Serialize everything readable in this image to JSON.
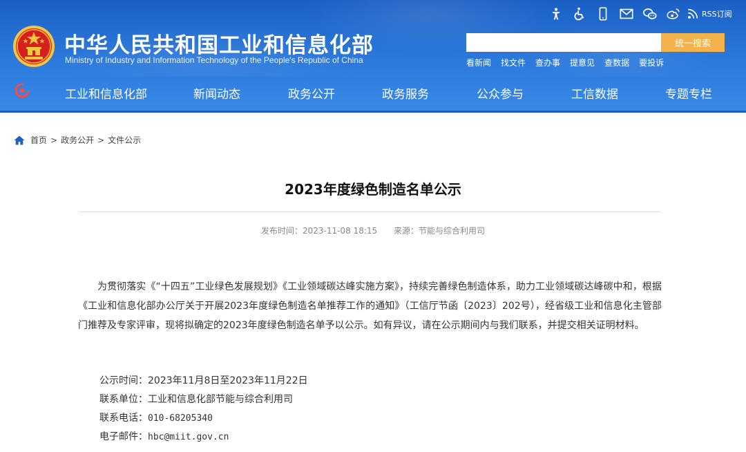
{
  "header": {
    "site_title": "中华人民共和国工业和信息化部",
    "site_subtitle": "Ministry of Industry and Information Technology of the People's Republic of China",
    "tool_icons": [
      "accessibility-icon",
      "wheelchair-icon",
      "mobile-icon",
      "mail-icon",
      "wechat-icon",
      "weibo-icon"
    ],
    "rss_label": "RSS订阅",
    "search": {
      "placeholder": "",
      "button_label": "统一搜索"
    },
    "quick_links": [
      "看新闻",
      "找文件",
      "查办事",
      "提意见",
      "查数据",
      "要投诉"
    ],
    "nav": [
      "工业和信息化部",
      "新闻动态",
      "政务公开",
      "政务服务",
      "公众参与",
      "工信数据",
      "专题专栏"
    ]
  },
  "breadcrumb": [
    "首页",
    "政务公开",
    "文件公示"
  ],
  "article": {
    "title": "2023年度绿色制造名单公示",
    "publish_time": "发布时间：2023-11-08 18:15",
    "source": "来源：节能与综合利用司",
    "paragraph": "为贯彻落实《“十四五”工业绿色发展规划》《工业领域碳达峰实施方案》，持续完善绿色制造体系，助力工业领域碳达峰碳中和，根据《工业和信息化部办公厅关于开展2023年度绿色制造名单推荐工作的通知》（工信厅节函〔2023〕202号），经省级工业和信息化主管部门推荐及专家评审，现将拟确定的2023年度绿色制造名单予以公示。如有异议，请在公示期间内与我们联系，并提交相关证明材料。",
    "publicity_label": "公示时间：",
    "publicity_value": "2023年11月8日至2023年11月22日",
    "unit_label": "联系单位：",
    "unit_value": "工业和信息化部节能与综合利用司",
    "phone_label": "联系电话：",
    "phone_value": "010-68205340",
    "email_label": "电子邮件：",
    "email_value": "hbc@miit.gov.cn"
  },
  "colors": {
    "header_blue": "#2a77da",
    "search_button": "#f3b24b",
    "emblem_red": "#d6201c",
    "emblem_gold": "#f5c542"
  }
}
